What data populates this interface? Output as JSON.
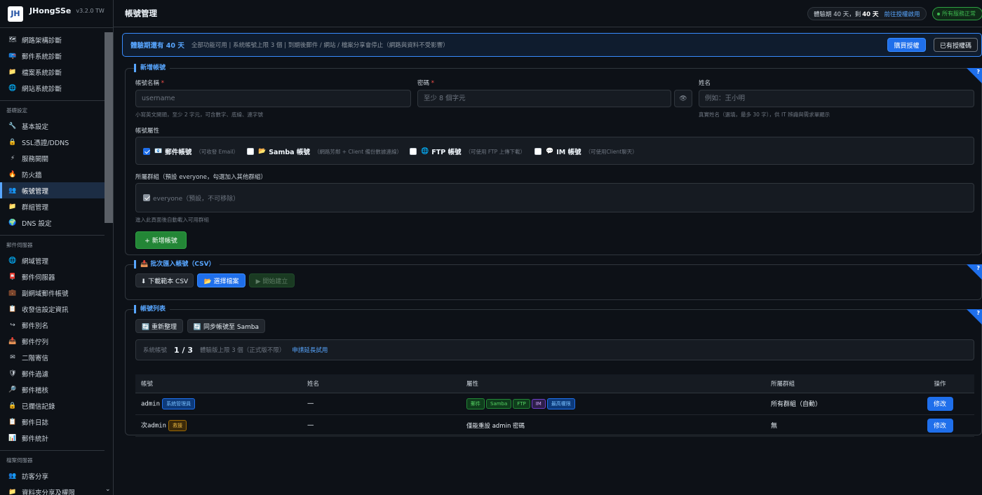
{
  "brand": {
    "logo": "JH",
    "name": "JHongSSe",
    "version": "v3.2.0  TW"
  },
  "sidebar": {
    "items_a": [
      {
        "icon": "🗺",
        "label": "網路架構診斷"
      },
      {
        "icon": "📪",
        "label": "郵件系統診斷"
      },
      {
        "icon": "📁",
        "label": "檔案系統診斷"
      },
      {
        "icon": "🌐",
        "label": "網站系統診斷"
      }
    ],
    "group_b": "基礎設定",
    "items_b": [
      {
        "icon": "🔧",
        "label": "基本設定"
      },
      {
        "icon": "🔒",
        "label": "SSL憑證/DDNS"
      },
      {
        "icon": "⚡",
        "label": "服務開關"
      },
      {
        "icon": "🔥",
        "label": "防火牆"
      },
      {
        "icon": "👥",
        "label": "帳號管理"
      },
      {
        "icon": "📁",
        "label": "群組管理"
      },
      {
        "icon": "🌍",
        "label": "DNS 設定"
      }
    ],
    "group_c": "郵件伺服器",
    "items_c": [
      {
        "icon": "🌐",
        "label": "網域管理"
      },
      {
        "icon": "📮",
        "label": "郵件伺服器"
      },
      {
        "icon": "💼",
        "label": "副網域郵件帳號"
      },
      {
        "icon": "📋",
        "label": "收發信設定資訊"
      },
      {
        "icon": "↪",
        "label": "郵件別名"
      },
      {
        "icon": "📥",
        "label": "郵件佇列"
      },
      {
        "icon": "✉",
        "label": "二階寄信"
      },
      {
        "icon": "🛡",
        "label": "郵件過濾"
      },
      {
        "icon": "🔎",
        "label": "郵件稽核"
      },
      {
        "icon": "🔒",
        "label": "已攔信記錄"
      },
      {
        "icon": "📋",
        "label": "郵件日誌"
      },
      {
        "icon": "📊",
        "label": "郵件統計"
      }
    ],
    "group_d": "檔案伺服器",
    "items_d": [
      {
        "icon": "👥",
        "label": "訪客分享"
      },
      {
        "icon": "📁",
        "label": "資料夾分享及權限"
      }
    ]
  },
  "topbar": {
    "title": "帳號管理",
    "trial_prefix": "體驗期 40 天，剩",
    "trial_days": "40 天",
    "trial_link": "前往授權啟用",
    "status": "所有服務正常"
  },
  "banner": {
    "strong": "體驗期還有 40 天",
    "text": "全部功能可用 | 系統帳號上限 3 個 | 到期後郵件 / 網站 / 檔案分享會停止（網路與資料不受影響）",
    "buy": "購買授權",
    "have": "已有授權碼"
  },
  "add_account": {
    "title": "新增帳號",
    "username_label": "帳號名稱",
    "username_placeholder": "username",
    "username_hint": "小寫英文開頭，至少 2 字元，可含數字、底線、連字號",
    "password_label": "密碼",
    "password_placeholder": "至少 8 個字元",
    "name_label": "姓名",
    "name_placeholder": "例如：王小明",
    "name_hint": "真實姓名（選填，最多 30 字），供 IT 辨識與需求單顯示",
    "attr_label": "帳號屬性",
    "attrs": [
      {
        "icon": "📧",
        "name": "郵件帳號",
        "desc": "（可收發 Email）",
        "checked": true
      },
      {
        "icon": "📂",
        "name": "Samba 帳號",
        "desc": "（網路芳鄰 + Client 備份數據連線）",
        "checked": false
      },
      {
        "icon": "🌐",
        "name": "FTP 帳號",
        "desc": "（可使用 FTP 上傳下載）",
        "checked": false
      },
      {
        "icon": "💬",
        "name": "IM 帳號",
        "desc": "（可使用Client聊天）",
        "checked": false
      }
    ],
    "group_label": "所屬群組（預設 everyone，勾選加入其他群組）",
    "group_default": "everyone（預設，不可移除）",
    "group_hint": "進入此頁面後自動載入可用群組",
    "submit": "+ 新增帳號"
  },
  "csv": {
    "title": "📥 批次匯入帳號（CSV）",
    "download": "⬇ 下載範本 CSV",
    "choose": "📂 選擇檔案",
    "start": "▶ 開始建立"
  },
  "list": {
    "title": "帳號列表",
    "refresh": "🔄 重新整理",
    "sync": "🔄 同步帳號至 Samba",
    "count_label": "系統帳號",
    "count_value": "1 / 3",
    "count_note": "體驗版上限 3 個（正式版不限）",
    "count_link": "申請延長試用",
    "columns": [
      "帳號",
      "姓名",
      "屬性",
      "所屬群組",
      "操作"
    ],
    "rows": [
      {
        "account": "admin",
        "badge": "系統管理員",
        "name": "—",
        "attrs": [
          "郵件",
          "Samba",
          "FTP",
          "IM",
          "最高權限"
        ],
        "group": "所有群組（自動）",
        "action": "修改"
      },
      {
        "account": "次admin",
        "badge": "救援",
        "name": "—",
        "attrs_text": "僅能重設 admin 密碼",
        "group": "無",
        "action": "修改"
      }
    ]
  }
}
